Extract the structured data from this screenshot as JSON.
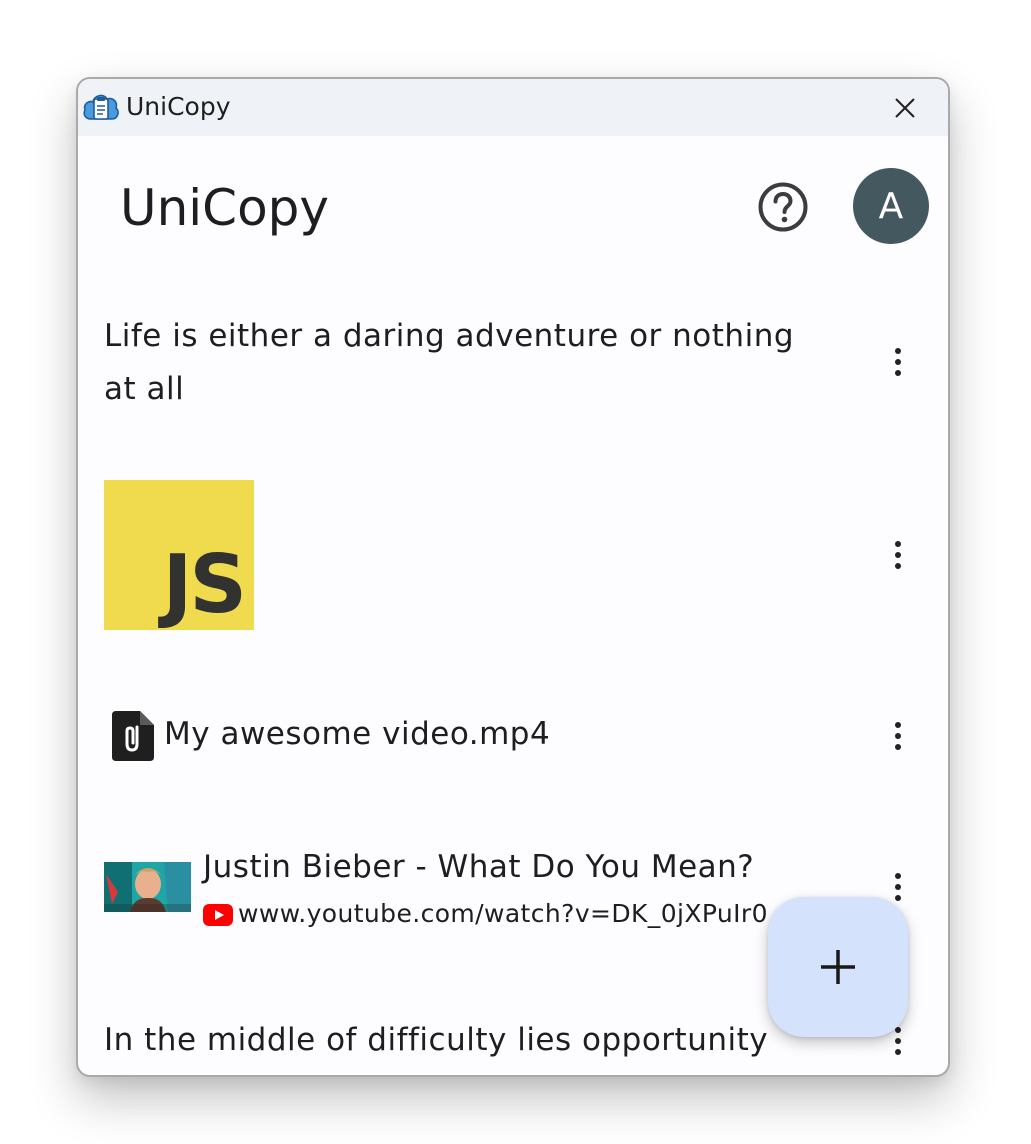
{
  "titlebar": {
    "title": "UniCopy",
    "app_icon": "cloud-clipboard-icon",
    "close_icon": "close-icon"
  },
  "header": {
    "title": "UniCopy",
    "help_icon": "help-circle-icon",
    "avatar_letter": "A"
  },
  "clips": [
    {
      "type": "text",
      "text": "Life is either a daring adventure or nothing at all",
      "menu_icon": "more-vertical-icon"
    },
    {
      "type": "image",
      "image_text": "JS",
      "menu_icon": "more-vertical-icon"
    },
    {
      "type": "file",
      "filename": "My awesome video.mp4",
      "file_icon": "attachment-file-icon",
      "menu_icon": "more-vertical-icon"
    },
    {
      "type": "link",
      "title": "Justin Bieber - What Do You Mean?",
      "url": "www.youtube.com/watch?v=DK_0jXPuIr0",
      "site_icon": "youtube-icon",
      "menu_icon": "more-vertical-icon"
    },
    {
      "type": "text",
      "text": "In the middle of difficulty lies opportunity",
      "menu_icon": "more-vertical-icon"
    }
  ],
  "fab": {
    "icon": "plus-icon"
  },
  "colors": {
    "titlebar_bg": "#eff3f8",
    "window_bg": "#fdfcff",
    "avatar_bg": "#44585f",
    "fab_bg": "#d4e3fb",
    "js_yellow": "#f0db4f",
    "youtube_red": "#ff0000"
  }
}
